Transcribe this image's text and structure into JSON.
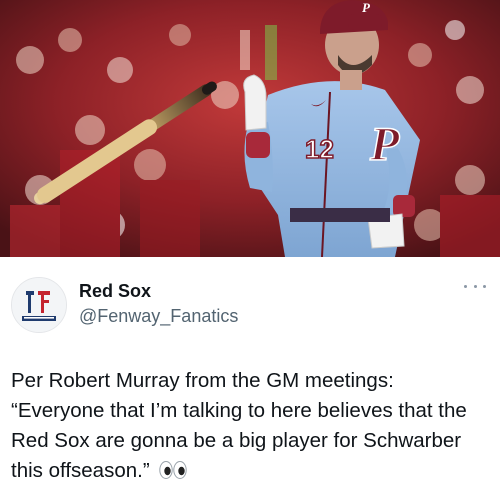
{
  "photo": {
    "alt": "Phillies player tossing bat",
    "jersey_number": "12",
    "jersey_logo": "P",
    "colors": {
      "jersey": "#8fb4dd",
      "maroon": "#7e1b2a",
      "crowd": "#a4262c",
      "bat": "#d9c08a"
    }
  },
  "tweet": {
    "display_name": "Red Sox",
    "handle": "@Fenway_Fanatics",
    "text": "Per Robert Murray from the GM meetings: “Everyone that I’m talking to here believes that the Red Sox are gonna be a big player for Schwarber this offseason.”",
    "emoji": "eyes-icon"
  },
  "avatar": {
    "logo_text": "FENWAY FANATICS"
  }
}
